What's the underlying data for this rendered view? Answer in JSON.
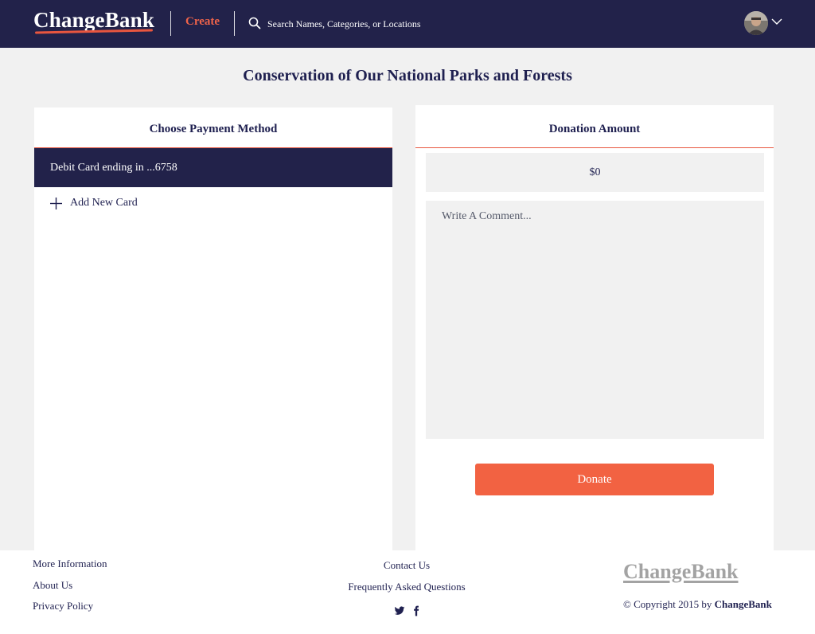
{
  "header": {
    "logo": "ChangeBank",
    "create_label": "Create",
    "search_placeholder": "Search Names, Categories, or Locations",
    "icons": {
      "search": "search-icon",
      "avatar": "avatar",
      "menu": "chevron-down-icon"
    }
  },
  "page": {
    "title": "Conservation of Our National Parks and Forests"
  },
  "payment": {
    "header": "Choose Payment Method",
    "selected_card": "Debit Card ending in ...6758",
    "add_card_label": "Add New Card"
  },
  "donation": {
    "header": "Donation Amount",
    "amount_value": "$0",
    "comment_placeholder": "Write A Comment...",
    "donate_label": "Donate"
  },
  "footer": {
    "col1": [
      "More Information",
      "About Us",
      "Privacy Policy"
    ],
    "col2": [
      "Contact Us",
      "Frequently Asked Questions"
    ],
    "social_icons": [
      "twitter-icon",
      "facebook-icon"
    ],
    "logo": "ChangeBank",
    "copyright_prefix": "© Copyright 2015 by ",
    "copyright_brand": "ChangeBank"
  },
  "colors": {
    "navy": "#22224a",
    "accent": "#f26242",
    "background": "#f1f1f1"
  }
}
